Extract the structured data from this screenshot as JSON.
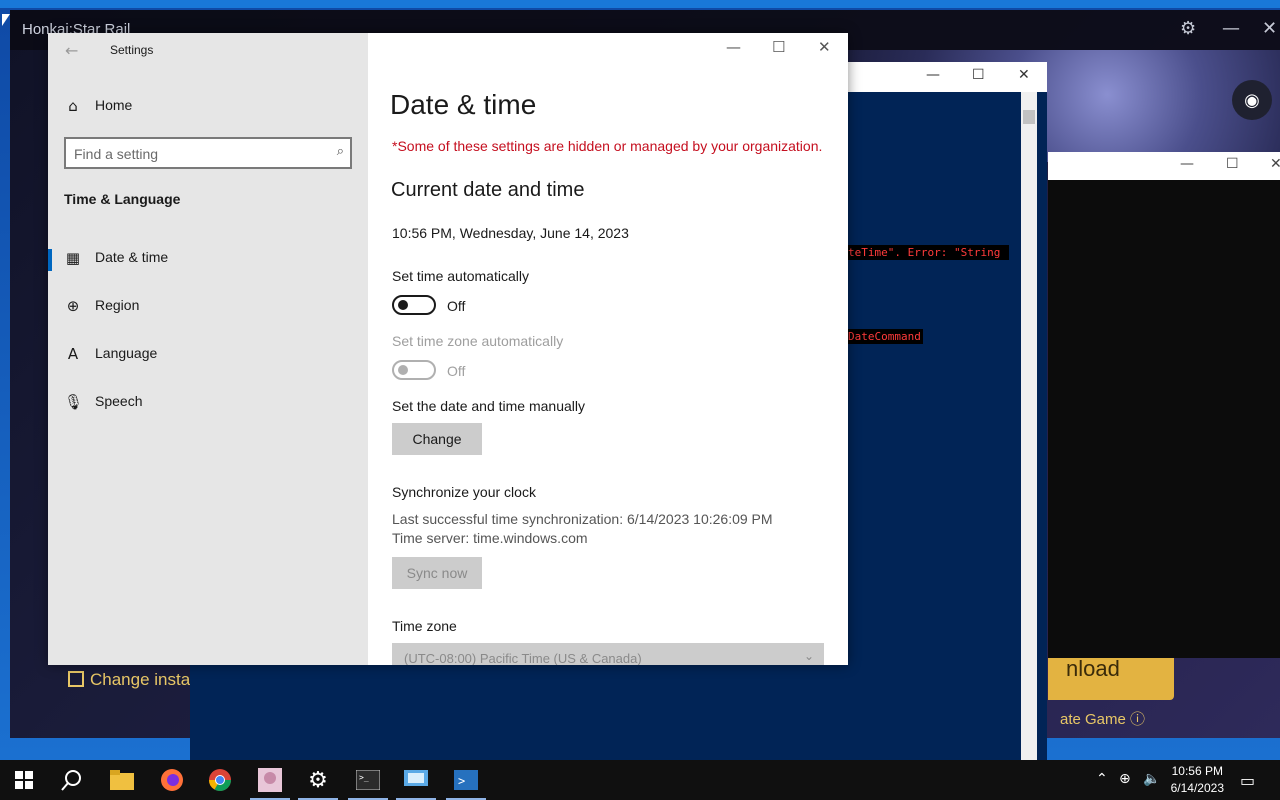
{
  "launcher": {
    "title": "Honkai:Star Rail",
    "change_install": "Change insta",
    "download": "nload",
    "update_game": "ate Game ⓘ"
  },
  "powershell": {
    "error_line_1": "teTime\". Error: \"String ",
    "error_line_2": "DateCommand"
  },
  "settings": {
    "window_title": "Settings",
    "nav": {
      "home": "Home",
      "search_placeholder": "Find a setting",
      "section": "Time & Language",
      "items": [
        {
          "label": "Date & time",
          "icon": "calendar-clock-icon",
          "active": true
        },
        {
          "label": "Region",
          "icon": "globe-icon",
          "active": false
        },
        {
          "label": "Language",
          "icon": "language-icon",
          "active": false
        },
        {
          "label": "Speech",
          "icon": "microphone-icon",
          "active": false
        }
      ]
    },
    "content": {
      "title": "Date & time",
      "org_warning": "*Some of these settings are hidden or managed by your organization.",
      "current_heading": "Current date and time",
      "current_datetime": "10:56 PM, Wednesday, June 14, 2023",
      "auto_time_label": "Set time automatically",
      "auto_time_state": "Off",
      "auto_tz_label": "Set time zone automatically",
      "auto_tz_state": "Off",
      "manual_label": "Set the date and time manually",
      "change_button": "Change",
      "sync_heading": "Synchronize your clock",
      "sync_last": "Last successful time synchronization: 6/14/2023 10:26:09 PM",
      "sync_server": "Time server: time.windows.com",
      "sync_button": "Sync now",
      "tz_label": "Time zone",
      "tz_value": "(UTC-08:00) Pacific Time (US & Canada)"
    }
  },
  "taskbar": {
    "apps": [
      "windows-start-icon",
      "search-icon",
      "file-explorer-icon",
      "firefox-icon",
      "chrome-icon",
      "game-launcher-icon",
      "settings-gear-icon",
      "terminal-icon",
      "remote-desktop-icon",
      "powershell-icon"
    ],
    "time": "10:56 PM",
    "date": "6/14/2023"
  },
  "colors": {
    "accent": "#0067c0",
    "warning": "#c50f1f",
    "powershell_bg": "#012456"
  }
}
